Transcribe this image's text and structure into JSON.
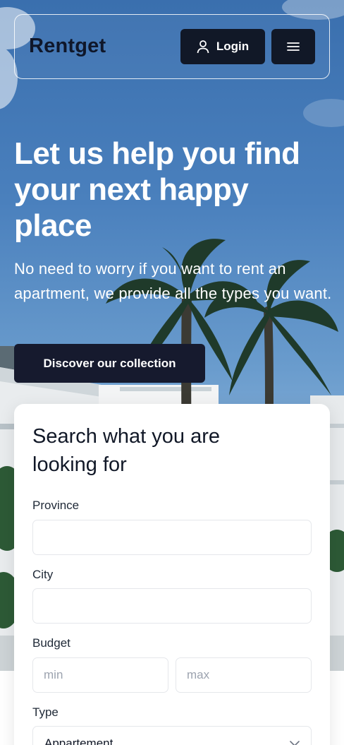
{
  "header": {
    "brand": "Rentget",
    "login_label": "Login",
    "login_icon": "user-icon",
    "menu_icon": "hamburger-menu-icon"
  },
  "hero": {
    "headline": "Let us help you find your next happy place",
    "subtext": "No need to worry if you want to rent an apartment, we provide all the types you want.",
    "cta_label": "Discover our collection"
  },
  "search": {
    "title": "Search what you are looking for",
    "province_label": "Province",
    "province_value": "",
    "city_label": "City",
    "city_value": "",
    "budget_label": "Budget",
    "budget_min_placeholder": "min",
    "budget_max_placeholder": "max",
    "type_label": "Type",
    "type_selected": "Appartement",
    "type_icon": "chevron-down-icon"
  },
  "colors": {
    "primary_dark": "#111827",
    "cta_dark": "#161a2e",
    "sky_blue": "#4a80bd",
    "white": "#ffffff"
  }
}
